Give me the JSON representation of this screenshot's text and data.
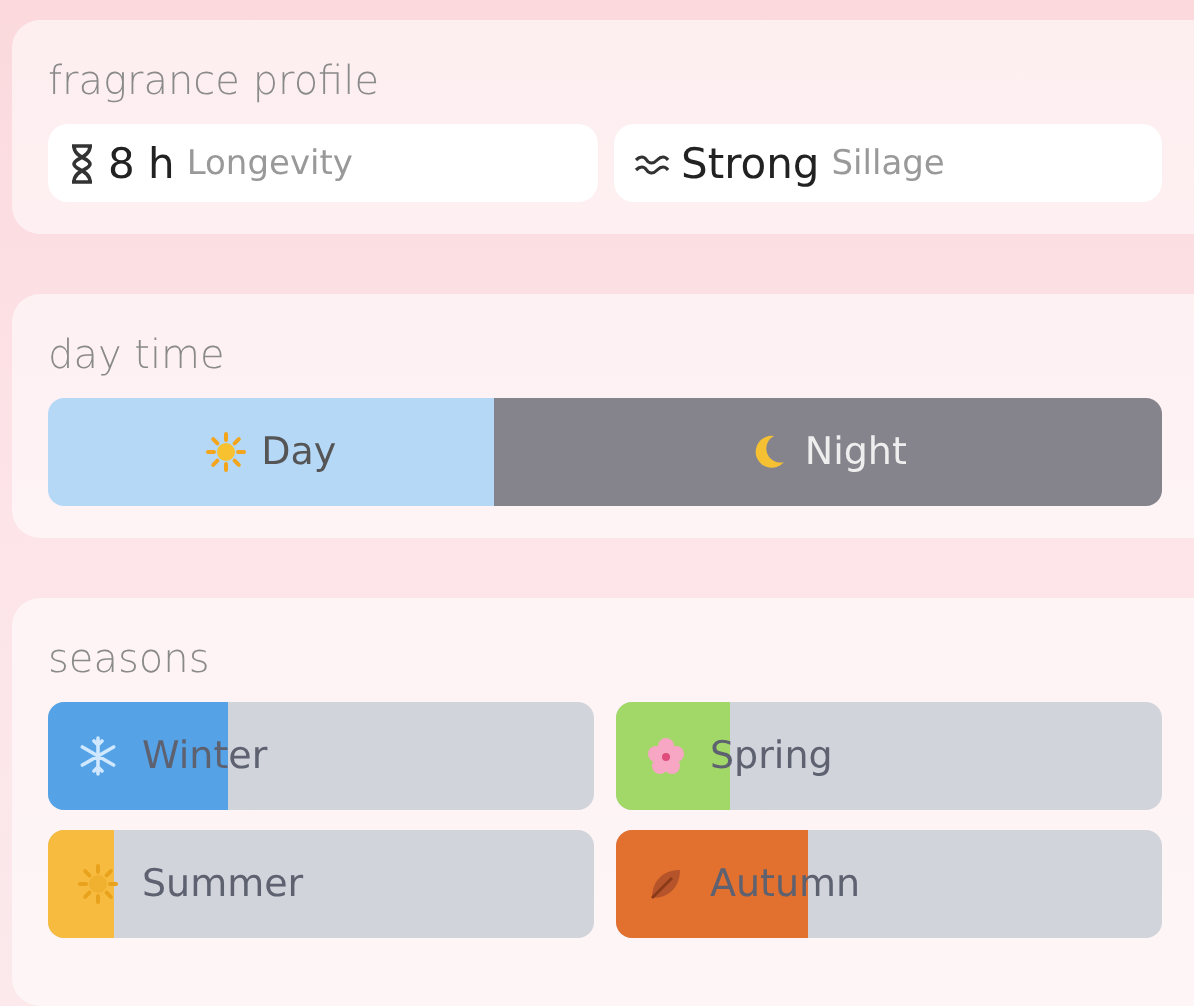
{
  "fragrance_profile": {
    "title": "fragrance profile",
    "stats": [
      {
        "kind": "longevity",
        "value": "8 h",
        "label": "Longevity"
      },
      {
        "kind": "sillage",
        "value": "Strong",
        "label": "Sillage"
      }
    ]
  },
  "day_time": {
    "title": "day time",
    "options": [
      {
        "kind": "day",
        "label": "Day"
      },
      {
        "kind": "night",
        "label": "Night"
      }
    ]
  },
  "seasons": {
    "title": "seasons",
    "items": [
      {
        "kind": "winter",
        "label": "Winter",
        "level": 0.33,
        "color": "#55a3e6"
      },
      {
        "kind": "spring",
        "label": "Spring",
        "level": 0.21,
        "color": "#a2d868"
      },
      {
        "kind": "summer",
        "label": "Summer",
        "level": 0.12,
        "color": "#f6bb3f"
      },
      {
        "kind": "autumn",
        "label": "Autumn",
        "level": 0.35,
        "color": "#e2702f"
      }
    ]
  }
}
